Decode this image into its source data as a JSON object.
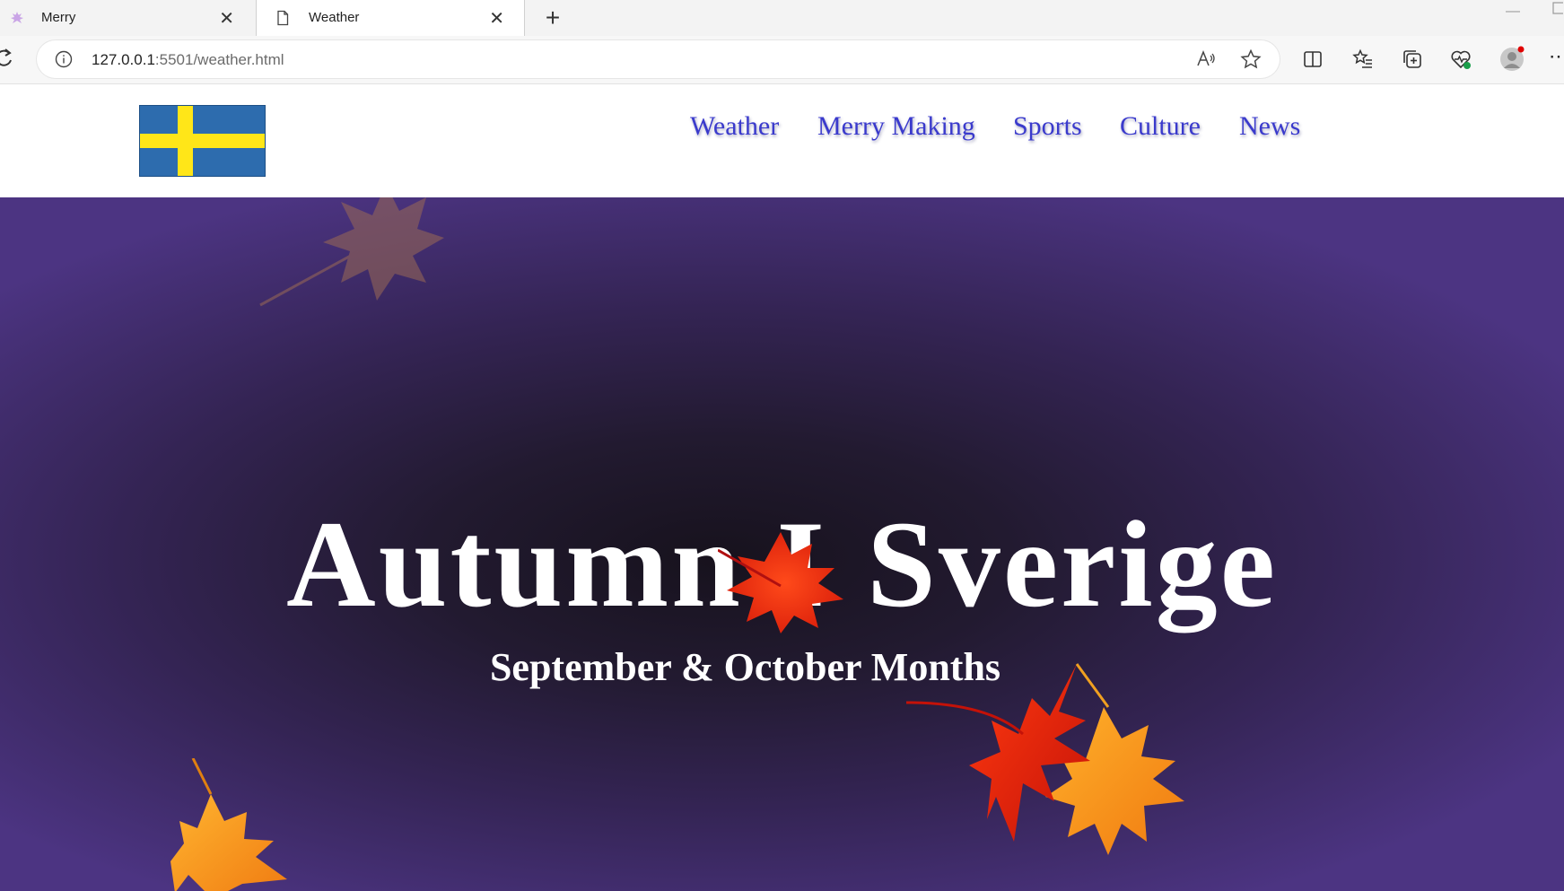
{
  "browser": {
    "tabs": [
      {
        "title": "Merry",
        "icon": "lotus-icon",
        "active": false
      },
      {
        "title": "Weather",
        "icon": "page-icon",
        "active": true
      }
    ],
    "url_host": "127.0.0.1",
    "url_rest": ":5501/weather.html"
  },
  "site": {
    "logo": "sweden-flag",
    "nav": [
      "Weather",
      "Merry Making",
      "Sports",
      "Culture",
      "News"
    ]
  },
  "hero": {
    "title_left": "Autumn I",
    "title_right": "Sverige",
    "subtitle": "September & October Months"
  },
  "colors": {
    "nav_text": "#3a3acc",
    "hero_dark": "#17121d",
    "hero_purple": "#4c3482",
    "flag_blue": "#2d6cae",
    "flag_yellow": "#ffe618"
  }
}
